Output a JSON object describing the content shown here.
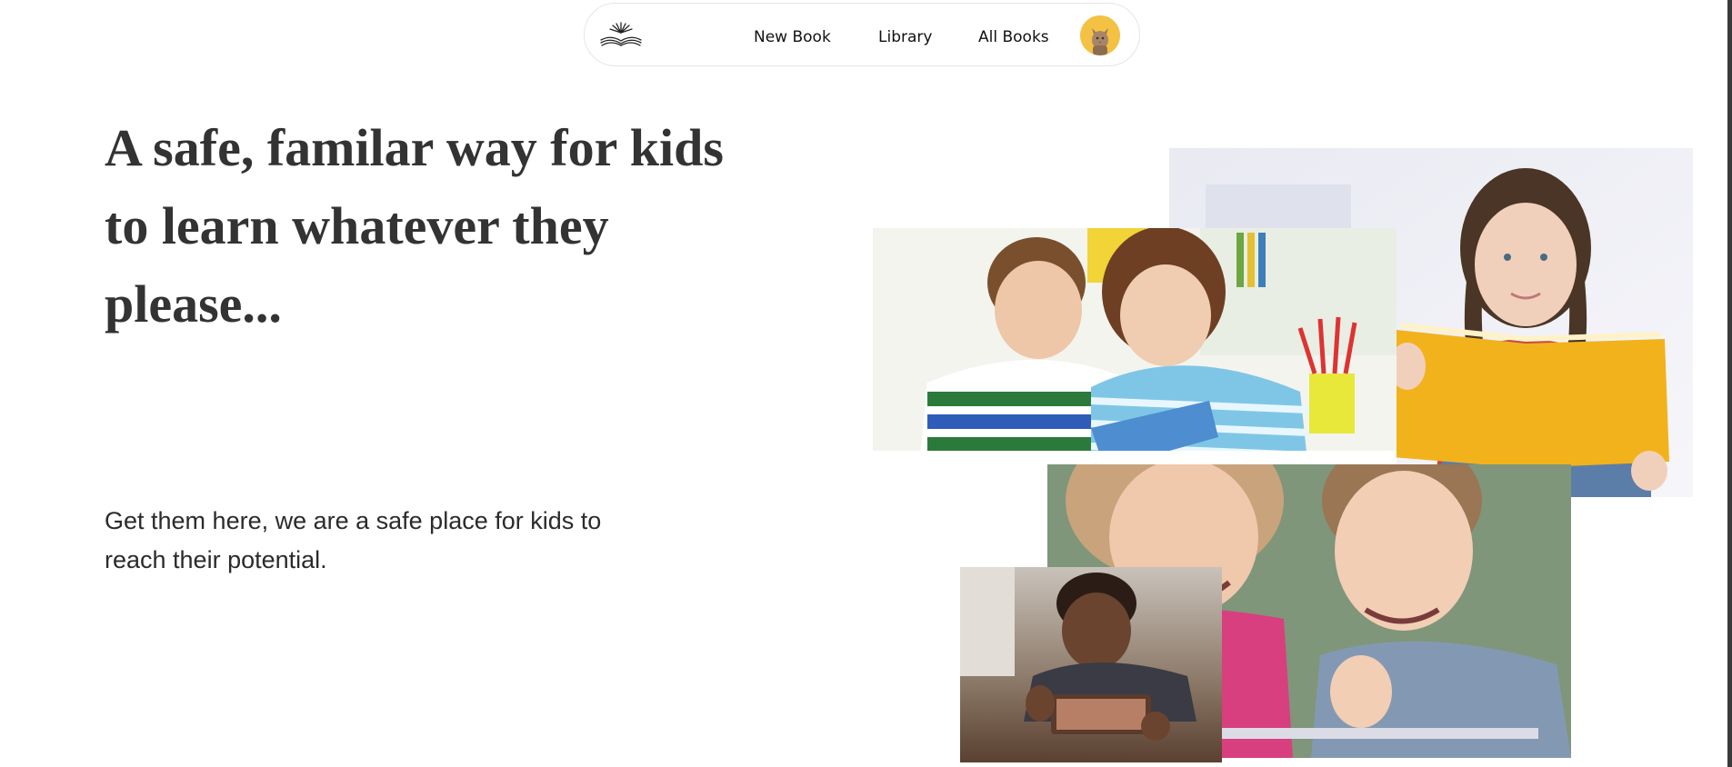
{
  "nav": {
    "logo_icon": "open-book-sunrise-icon",
    "links": [
      "New Book",
      "Library",
      "All Books"
    ],
    "avatar_icon": "cat-avatar-icon"
  },
  "hero": {
    "title": "A safe, familar way for kids to learn whatever they please...",
    "subtitle": "Get them here, we are a safe place for kids to reach their potential."
  },
  "colors": {
    "text": "#333333",
    "avatar_bg": "#f3c244",
    "nav_border": "#e6e6e6"
  }
}
